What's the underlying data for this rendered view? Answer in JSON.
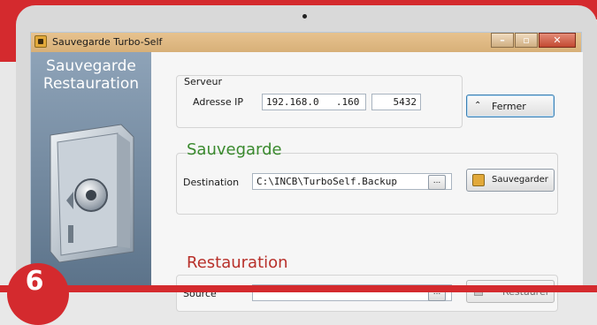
{
  "window": {
    "title": "Sauvegarde Turbo-Self"
  },
  "left_panel": {
    "title_line1": "Sauvegarde",
    "title_line2": "Restauration"
  },
  "serveur": {
    "group_label": "Serveur",
    "ip_label": "Adresse IP",
    "ip_value": "192.168.0",
    "ip_last": ".160",
    "port": "5432"
  },
  "fermer_label": "Fermer",
  "sauvegarde": {
    "title": "Sauvegarde",
    "destination_label": "Destination",
    "destination_value": "C:\\INCB\\TurboSelf.Backup",
    "browse_label": "...",
    "button_label": "Sauvegarder"
  },
  "restauration": {
    "title": "Restauration",
    "source_label": "Source",
    "source_value": "",
    "browse_label": "...",
    "button_label": "Restaurer"
  },
  "step_number": "6",
  "colors": {
    "sauvegarde_title": "#3a8a2e",
    "restauration_title": "#b8302a",
    "accent_red": "#d42a2e"
  }
}
